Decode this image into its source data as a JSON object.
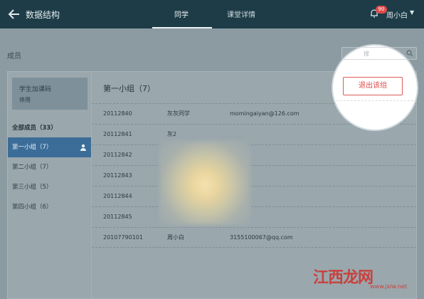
{
  "header": {
    "title": "数据结构",
    "tabs": [
      {
        "label": "同学",
        "active": true
      },
      {
        "label": "课堂详情",
        "active": false
      }
    ],
    "notification_count": "90",
    "user_name": "周小白",
    "caret": "▼"
  },
  "members": {
    "title": "成员",
    "search_placeholder": "搜"
  },
  "sidebar": {
    "class_code_label": "学生加课码",
    "class_code_state": "停用",
    "all_members": "全部成员（33）",
    "groups": [
      {
        "label": "第一小组（7）",
        "active": true
      },
      {
        "label": "第二小组（7）",
        "active": false
      },
      {
        "label": "第三小组（5）",
        "active": false
      },
      {
        "label": "第四小组（6）",
        "active": false
      }
    ]
  },
  "group": {
    "title": "第一小组（7）",
    "exit_label": "退出该组",
    "rows": [
      {
        "id": "20112840",
        "name": "灰灰同学",
        "email": "momingaiyan@126.com"
      },
      {
        "id": "20112841",
        "name": "灰2",
        "email": ""
      },
      {
        "id": "20112842",
        "name": "",
        "email": ""
      },
      {
        "id": "20112843",
        "name": "",
        "email": ""
      },
      {
        "id": "20112844",
        "name": "",
        "email": ""
      },
      {
        "id": "20112845",
        "name": "灰6",
        "email": ""
      },
      {
        "id": "20107790101",
        "name": "周小白",
        "email": "3155100067@qq.com"
      }
    ]
  },
  "watermark": {
    "text": "江西龙网",
    "url": "www.jxlw.net"
  },
  "colors": {
    "topbar": "#1d3c47",
    "active_group": "#3c6d98",
    "exit_red": "#e04848"
  }
}
